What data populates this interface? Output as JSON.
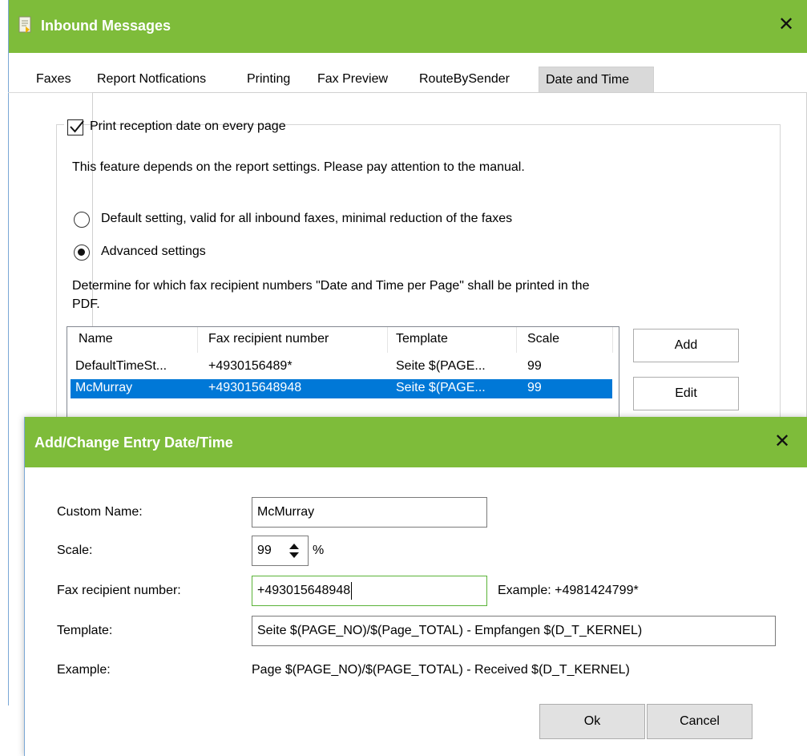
{
  "main_window": {
    "title": "Inbound Messages",
    "close_glyph": "✕",
    "tabs": [
      {
        "label": "Faxes"
      },
      {
        "label": "Report Notfications"
      },
      {
        "label": "Printing"
      },
      {
        "label": "Fax Preview"
      },
      {
        "label": "RouteBySender"
      },
      {
        "label": "Date and Time",
        "active": true
      }
    ],
    "print_checkbox": {
      "label": "Print reception date on every page",
      "checked": true
    },
    "feature_note": "This feature depends on the report settings. Please pay attention to the manual.",
    "radio_default": {
      "label": "Default setting, valid for all inbound faxes, minimal reduction of the faxes",
      "selected": false
    },
    "radio_advanced": {
      "label": "Advanced settings",
      "selected": true
    },
    "determine_text_line1": "Determine for which fax recipient numbers \"Date and Time per Page\" shall be printed in the",
    "determine_text_line2": "PDF.",
    "list": {
      "columns": [
        "Name",
        "Fax recipient number",
        "Template",
        "Scale"
      ],
      "rows": [
        {
          "name": "DefaultTimeSt...",
          "fax": "+4930156489*",
          "template": "Seite $(PAGE...",
          "scale": "99",
          "selected": false
        },
        {
          "name": "McMurray",
          "fax": "+493015648948",
          "template": "Seite $(PAGE...",
          "scale": "99",
          "selected": true
        }
      ]
    },
    "buttons": {
      "add": "Add",
      "edit": "Edit"
    }
  },
  "dialog": {
    "title": "Add/Change Entry Date/Time",
    "close_glyph": "✕",
    "custom_name_label": "Custom Name:",
    "custom_name_value": "McMurray",
    "scale_label": "Scale:",
    "scale_value": "99",
    "scale_unit": "%",
    "fax_label": "Fax recipient number:",
    "fax_value": "+493015648948",
    "fax_example": "Example: +4981424799*",
    "template_label": "Template:",
    "template_value": "Seite $(PAGE_NO)/$(Page_TOTAL) - Empfangen $(D_T_KERNEL)",
    "example_label": "Example:",
    "example_value": "Page $(PAGE_NO)/$(PAGE_TOTAL) - Received $(D_T_KERNEL)",
    "ok_label": "Ok",
    "cancel_label": "Cancel"
  },
  "colors": {
    "title_bar": "#7ebc3a",
    "selection": "#0078d7",
    "focus_border": "#5ab338"
  }
}
